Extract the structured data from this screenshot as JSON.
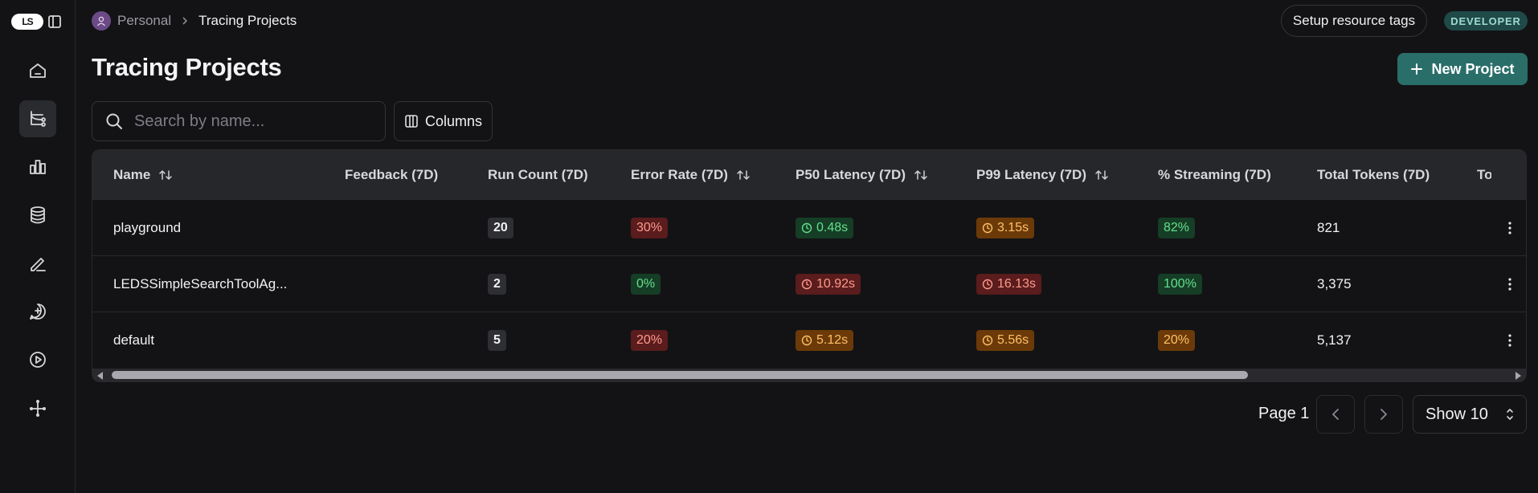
{
  "sidebar": {
    "logo_text": "LS",
    "items": [
      {
        "icon": "home-icon",
        "label": "Home"
      },
      {
        "icon": "tracing-icon",
        "label": "Tracing Projects",
        "active": true
      },
      {
        "icon": "monitoring-icon",
        "label": "Monitoring"
      },
      {
        "icon": "datasets-icon",
        "label": "Datasets"
      },
      {
        "icon": "annotation-icon",
        "label": "Annotation"
      },
      {
        "icon": "prompts-icon",
        "label": "Prompts"
      },
      {
        "icon": "playground-icon",
        "label": "Playground"
      },
      {
        "icon": "deployments-icon",
        "label": "Deployments"
      }
    ]
  },
  "header": {
    "workspace": "Personal",
    "current": "Tracing Projects",
    "setup_tags_label": "Setup resource tags",
    "plan_badge": "DEVELOPER"
  },
  "page": {
    "title": "Tracing Projects",
    "new_project_label": "New Project",
    "search_placeholder": "Search by name...",
    "columns_label": "Columns"
  },
  "table": {
    "columns": [
      "Name",
      "Feedback (7D)",
      "Run Count (7D)",
      "Error Rate (7D)",
      "P50 Latency (7D)",
      "P99 Latency (7D)",
      "% Streaming (7D)",
      "Total Tokens (7D)",
      "To"
    ],
    "rows": [
      {
        "name": "playground",
        "feedback": "",
        "run_count": "20",
        "error_rate": "30%",
        "p50": "0.48s",
        "p99": "3.15s",
        "streaming": "82%",
        "tokens": "821"
      },
      {
        "name": "LEDSSimpleSearchToolAg...",
        "feedback": "",
        "run_count": "2",
        "error_rate": "0%",
        "p50": "10.92s",
        "p99": "16.13s",
        "streaming": "100%",
        "tokens": "3,375"
      },
      {
        "name": "default",
        "feedback": "",
        "run_count": "5",
        "error_rate": "20%",
        "p50": "5.12s",
        "p99": "5.56s",
        "streaming": "20%",
        "tokens": "5,137"
      }
    ]
  },
  "pagination": {
    "page_label": "Page 1",
    "show_label": "Show 10"
  },
  "colors": {
    "background": "#131315",
    "accent": "#2a6e6a",
    "badge_red": "#5a1c1c",
    "badge_green": "#163d26",
    "badge_orange": "#6b3a08"
  }
}
